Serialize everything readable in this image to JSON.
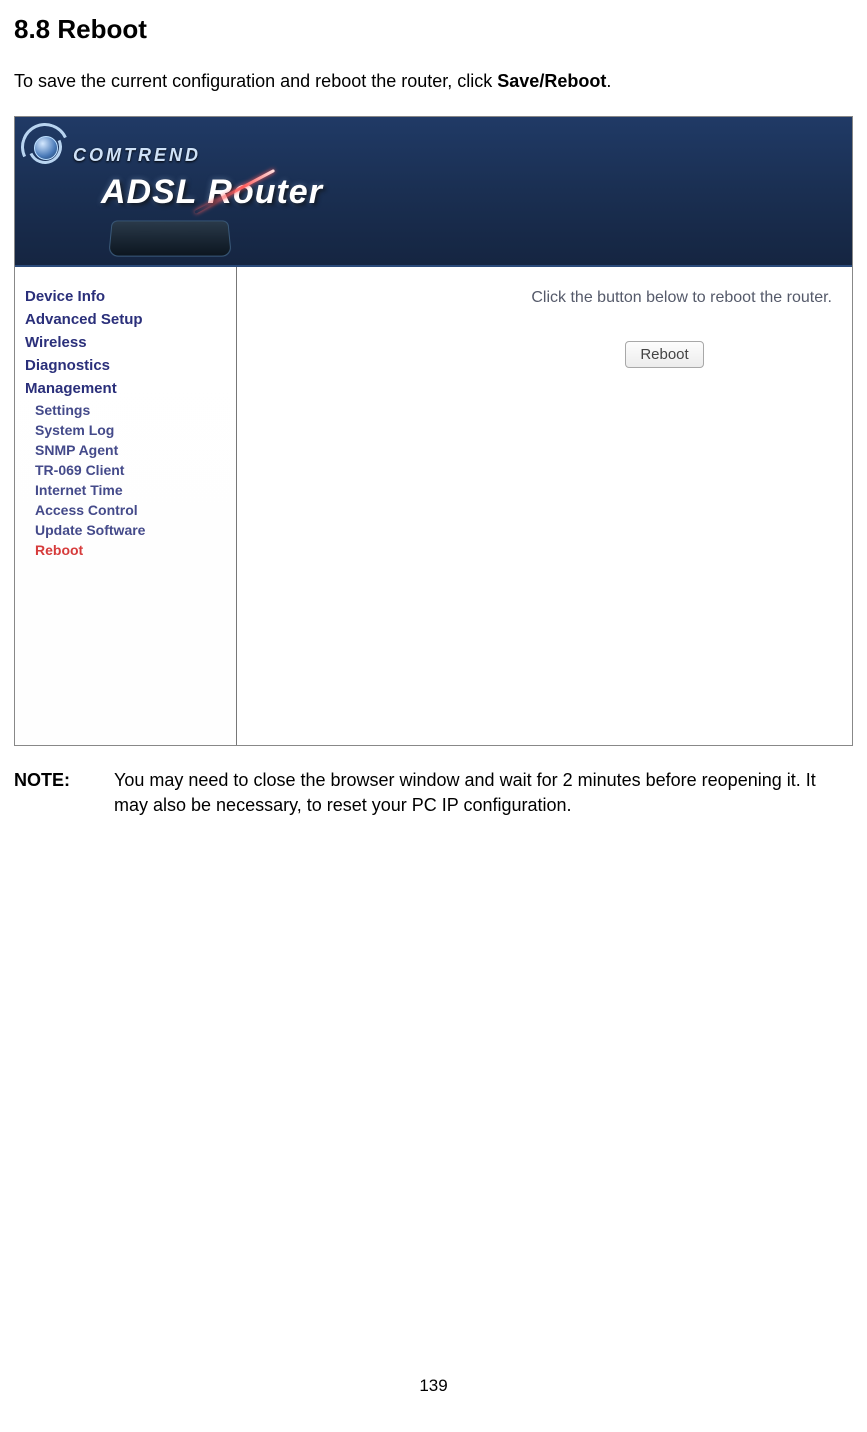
{
  "section": {
    "heading": "8.8  Reboot",
    "intro_prefix": "To save the current configuration and reboot the router, click ",
    "intro_bold": "Save/Reboot",
    "intro_suffix": "."
  },
  "banner": {
    "brand": "COMTREND",
    "product": "ADSL Router"
  },
  "sidebar": {
    "top": [
      "Device Info",
      "Advanced Setup",
      "Wireless",
      "Diagnostics",
      "Management"
    ],
    "sub": [
      "Settings",
      "System Log",
      "SNMP Agent",
      "TR-069 Client",
      "Internet Time",
      "Access Control",
      "Update Software",
      "Reboot"
    ],
    "active_sub": "Reboot"
  },
  "main": {
    "instruction": "Click the button below to reboot the router.",
    "button_label": "Reboot"
  },
  "note": {
    "label": "NOTE:",
    "body": "You may need to close the browser window and wait for 2 minutes before reopening it. It may also be necessary, to reset your PC IP configuration."
  },
  "page_number": "139"
}
